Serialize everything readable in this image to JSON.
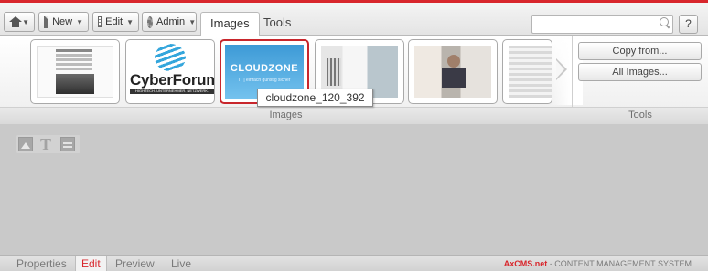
{
  "toolbar": {
    "home": {
      "icon": "home-icon"
    },
    "new_label": "New",
    "edit_label": "Edit",
    "admin_label": "Admin",
    "tabs": [
      {
        "label": "Images",
        "active": true
      },
      {
        "label": "Tools",
        "active": false
      }
    ],
    "search": {
      "value": "",
      "placeholder": ""
    },
    "help_label": "?"
  },
  "gallery": {
    "items": [
      {
        "name": "document-thumbnail",
        "selected": false
      },
      {
        "name": "cyberforum-logo",
        "selected": false,
        "title": "CyberForum",
        "subtitle": "HIGHTECH. UNTERNEHMER. NETZWERK."
      },
      {
        "name": "cloudzone-logo",
        "selected": true,
        "title": "CLOUDZONE",
        "subtitle": "IT | einfach günstig sicher"
      },
      {
        "name": "office-building-thumbnail",
        "selected": false
      },
      {
        "name": "person-thumbnail",
        "selected": false
      },
      {
        "name": "partial-thumbnail",
        "selected": false
      }
    ],
    "tooltip": "cloudzone_120_392"
  },
  "groups": {
    "images_label": "Images",
    "tools_label": "Tools"
  },
  "tools": {
    "copy_from_label": "Copy from...",
    "all_images_label": "All Images..."
  },
  "modes": {
    "tabs": [
      {
        "label": "Properties",
        "active": false
      },
      {
        "label": "Edit",
        "active": true
      },
      {
        "label": "Preview",
        "active": false
      },
      {
        "label": "Live",
        "active": false
      }
    ]
  },
  "brand": {
    "name": "AxCMS.net",
    "tagline": "- CONTENT MANAGEMENT SYSTEM"
  },
  "colors": {
    "accent": "#d8262c",
    "selected_border": "#c8262c",
    "ribbon_bg": "#f4f4f4",
    "canvas_bg": "#c9c9c9"
  }
}
